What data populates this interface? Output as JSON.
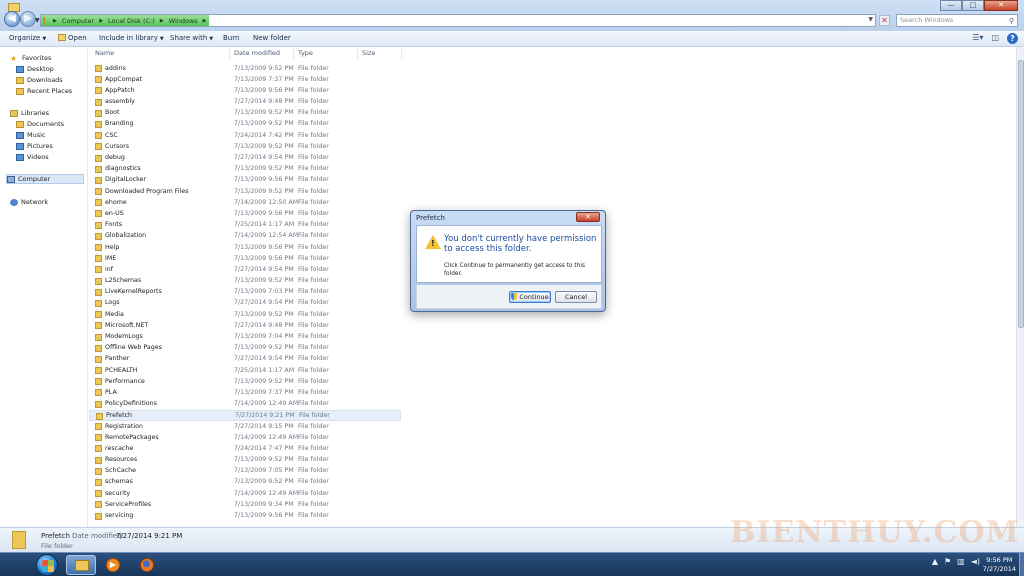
{
  "window": {
    "buttons": [
      "—",
      "□",
      "✕"
    ]
  },
  "address": {
    "crumbs": [
      "Computer",
      "Local Disk (C:)",
      "Windows"
    ],
    "search_placeholder": "Search Windows"
  },
  "toolbar": {
    "organize": "Organize",
    "open": "Open",
    "include": "Include in library",
    "share": "Share with",
    "burn": "Burn",
    "new_folder": "New folder"
  },
  "nav": {
    "favorites": "Favorites",
    "desktop": "Desktop",
    "downloads": "Downloads",
    "recent": "Recent Places",
    "libraries": "Libraries",
    "documents": "Documents",
    "music": "Music",
    "pictures": "Pictures",
    "videos": "Videos",
    "computer": "Computer",
    "network": "Network"
  },
  "columns": {
    "name": "Name",
    "date": "Date modified",
    "type": "Type",
    "size": "Size"
  },
  "files": [
    {
      "name": "addins",
      "date": "7/13/2009 9:52 PM",
      "type": "File folder"
    },
    {
      "name": "AppCompat",
      "date": "7/13/2009 7:37 PM",
      "type": "File folder"
    },
    {
      "name": "AppPatch",
      "date": "7/13/2009 9:56 PM",
      "type": "File folder"
    },
    {
      "name": "assembly",
      "date": "7/27/2014 9:48 PM",
      "type": "File folder"
    },
    {
      "name": "Boot",
      "date": "7/13/2009 9:52 PM",
      "type": "File folder"
    },
    {
      "name": "Branding",
      "date": "7/13/2009 9:52 PM",
      "type": "File folder"
    },
    {
      "name": "CSC",
      "date": "7/24/2014 7:42 PM",
      "type": "File folder"
    },
    {
      "name": "Cursors",
      "date": "7/13/2009 9:52 PM",
      "type": "File folder"
    },
    {
      "name": "debug",
      "date": "7/27/2014 9:54 PM",
      "type": "File folder"
    },
    {
      "name": "diagnostics",
      "date": "7/13/2009 9:52 PM",
      "type": "File folder"
    },
    {
      "name": "DigitalLocker",
      "date": "7/13/2009 9:56 PM",
      "type": "File folder"
    },
    {
      "name": "Downloaded Program Files",
      "date": "7/13/2009 9:52 PM",
      "type": "File folder"
    },
    {
      "name": "ehome",
      "date": "7/14/2009 12:50 AM",
      "type": "File folder"
    },
    {
      "name": "en-US",
      "date": "7/13/2009 9:56 PM",
      "type": "File folder"
    },
    {
      "name": "Fonts",
      "date": "7/25/2014 1:17 AM",
      "type": "File folder"
    },
    {
      "name": "Globalization",
      "date": "7/14/2009 12:54 AM",
      "type": "File folder"
    },
    {
      "name": "Help",
      "date": "7/13/2009 9:56 PM",
      "type": "File folder"
    },
    {
      "name": "IME",
      "date": "7/13/2009 9:56 PM",
      "type": "File folder"
    },
    {
      "name": "inf",
      "date": "7/27/2014 9:54 PM",
      "type": "File folder"
    },
    {
      "name": "L2Schemas",
      "date": "7/13/2009 9:52 PM",
      "type": "File folder"
    },
    {
      "name": "LiveKernelReports",
      "date": "7/13/2009 7:03 PM",
      "type": "File folder"
    },
    {
      "name": "Logs",
      "date": "7/27/2014 9:54 PM",
      "type": "File folder"
    },
    {
      "name": "Media",
      "date": "7/13/2009 9:52 PM",
      "type": "File folder"
    },
    {
      "name": "Microsoft.NET",
      "date": "7/27/2014 9:48 PM",
      "type": "File folder"
    },
    {
      "name": "ModemLogs",
      "date": "7/13/2009 7:04 PM",
      "type": "File folder"
    },
    {
      "name": "Offline Web Pages",
      "date": "7/13/2009 9:52 PM",
      "type": "File folder"
    },
    {
      "name": "Panther",
      "date": "7/27/2014 9:54 PM",
      "type": "File folder"
    },
    {
      "name": "PCHEALTH",
      "date": "7/25/2014 1:17 AM",
      "type": "File folder"
    },
    {
      "name": "Performance",
      "date": "7/13/2009 9:52 PM",
      "type": "File folder"
    },
    {
      "name": "PLA",
      "date": "7/13/2009 7:37 PM",
      "type": "File folder"
    },
    {
      "name": "PolicyDefinitions",
      "date": "7/14/2009 12:49 AM",
      "type": "File folder"
    },
    {
      "name": "Prefetch",
      "date": "7/27/2014 9:21 PM",
      "type": "File folder",
      "selected": true
    },
    {
      "name": "Registration",
      "date": "7/27/2014 9:15 PM",
      "type": "File folder"
    },
    {
      "name": "RemotePackages",
      "date": "7/14/2009 12:49 AM",
      "type": "File folder"
    },
    {
      "name": "rescache",
      "date": "7/24/2014 7:47 PM",
      "type": "File folder"
    },
    {
      "name": "Resources",
      "date": "7/13/2009 9:52 PM",
      "type": "File folder"
    },
    {
      "name": "SchCache",
      "date": "7/13/2009 7:05 PM",
      "type": "File folder"
    },
    {
      "name": "schemas",
      "date": "7/13/2009 9:52 PM",
      "type": "File folder"
    },
    {
      "name": "security",
      "date": "7/14/2009 12:49 AM",
      "type": "File folder"
    },
    {
      "name": "ServiceProfiles",
      "date": "7/13/2009 9:34 PM",
      "type": "File folder"
    },
    {
      "name": "servicing",
      "date": "7/13/2009 9:56 PM",
      "type": "File folder"
    }
  ],
  "details": {
    "name": "Prefetch",
    "modified_label": "Date modified:",
    "modified_value": "7/27/2014 9:21 PM",
    "type": "File folder"
  },
  "dialog": {
    "title": "Prefetch",
    "close": "✕",
    "heading": "You don't currently have permission to access this folder.",
    "text": "Click Continue to permanently get access to this folder.",
    "continue": "Continue",
    "cancel": "Cancel"
  },
  "taskbar": {
    "time": "9:56 PM",
    "date": "7/27/2014"
  },
  "watermark": "BIENTHUY.COM",
  "icons": {
    "back": "back-arrow-icon",
    "forward": "forward-arrow-icon",
    "search": "magnifier-icon",
    "warning": "warning-icon",
    "shield": "uac-shield-icon",
    "help": "help-icon"
  },
  "colors": {
    "breadcrumb_highlight": "#57c45a",
    "dialog_heading": "#1b4ba0",
    "taskbar": "#173558",
    "close_button": "#c7432a"
  }
}
